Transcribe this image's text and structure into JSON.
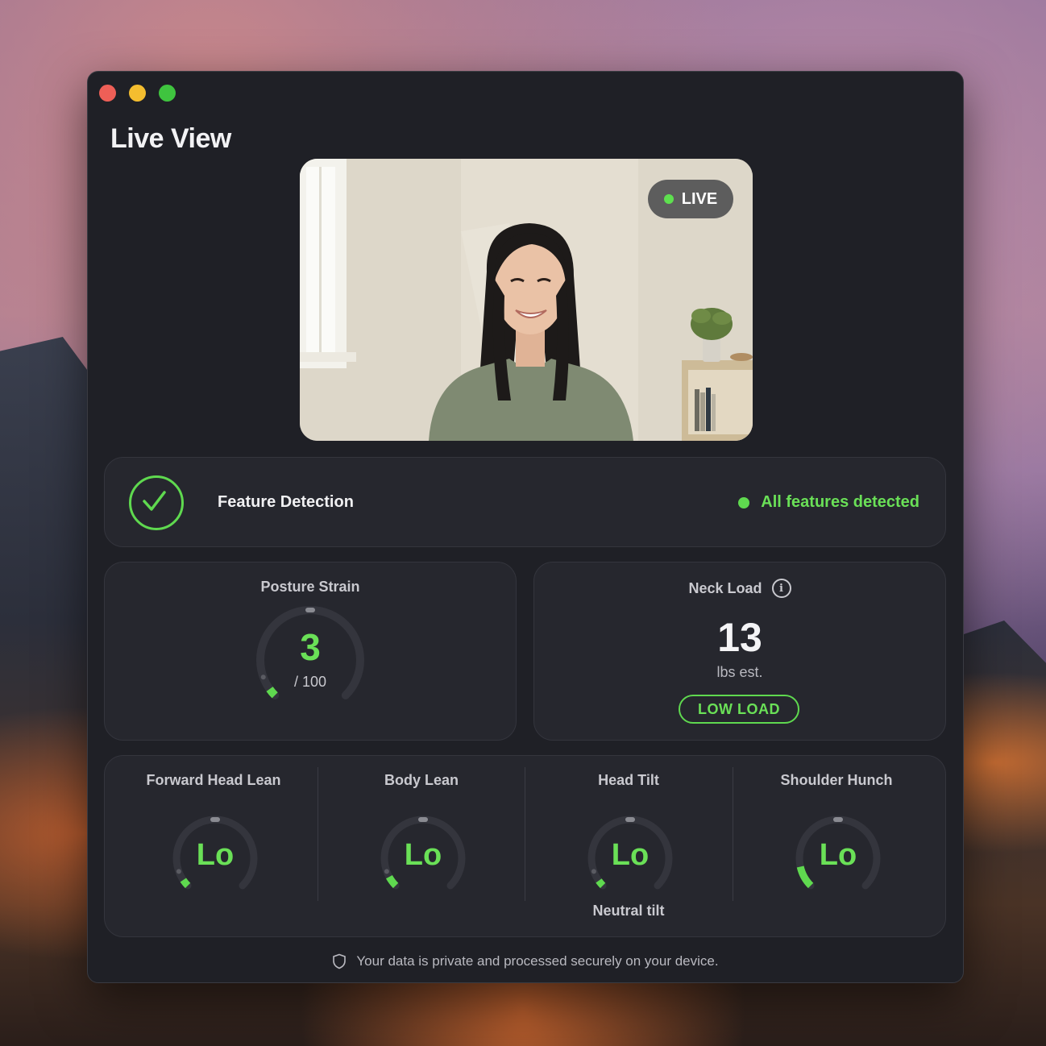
{
  "window": {
    "title": "Live View"
  },
  "camera": {
    "badge": "LIVE"
  },
  "feature_detection": {
    "label": "Feature Detection",
    "status": "All features detected"
  },
  "posture_strain": {
    "title": "Posture Strain",
    "value": "3",
    "max_label": "/ 100",
    "fraction": 0.03
  },
  "neck_load": {
    "title": "Neck Load",
    "value": "13",
    "unit": "lbs est.",
    "level": "LOW LOAD"
  },
  "metrics": [
    {
      "title": "Forward Head Lean",
      "value": "Lo",
      "note": "",
      "fraction": 0.04
    },
    {
      "title": "Body Lean",
      "value": "Lo",
      "note": "",
      "fraction": 0.06
    },
    {
      "title": "Head Tilt",
      "value": "Lo",
      "note": "Neutral tilt",
      "fraction": 0.0
    },
    {
      "title": "Shoulder Hunch",
      "value": "Lo",
      "note": "",
      "fraction": 0.12
    }
  ],
  "privacy": {
    "text": "Your data is private and processed securely on your device."
  },
  "colors": {
    "accent": "#5fd94f",
    "background": "#1f2026",
    "card": "#26272e"
  }
}
